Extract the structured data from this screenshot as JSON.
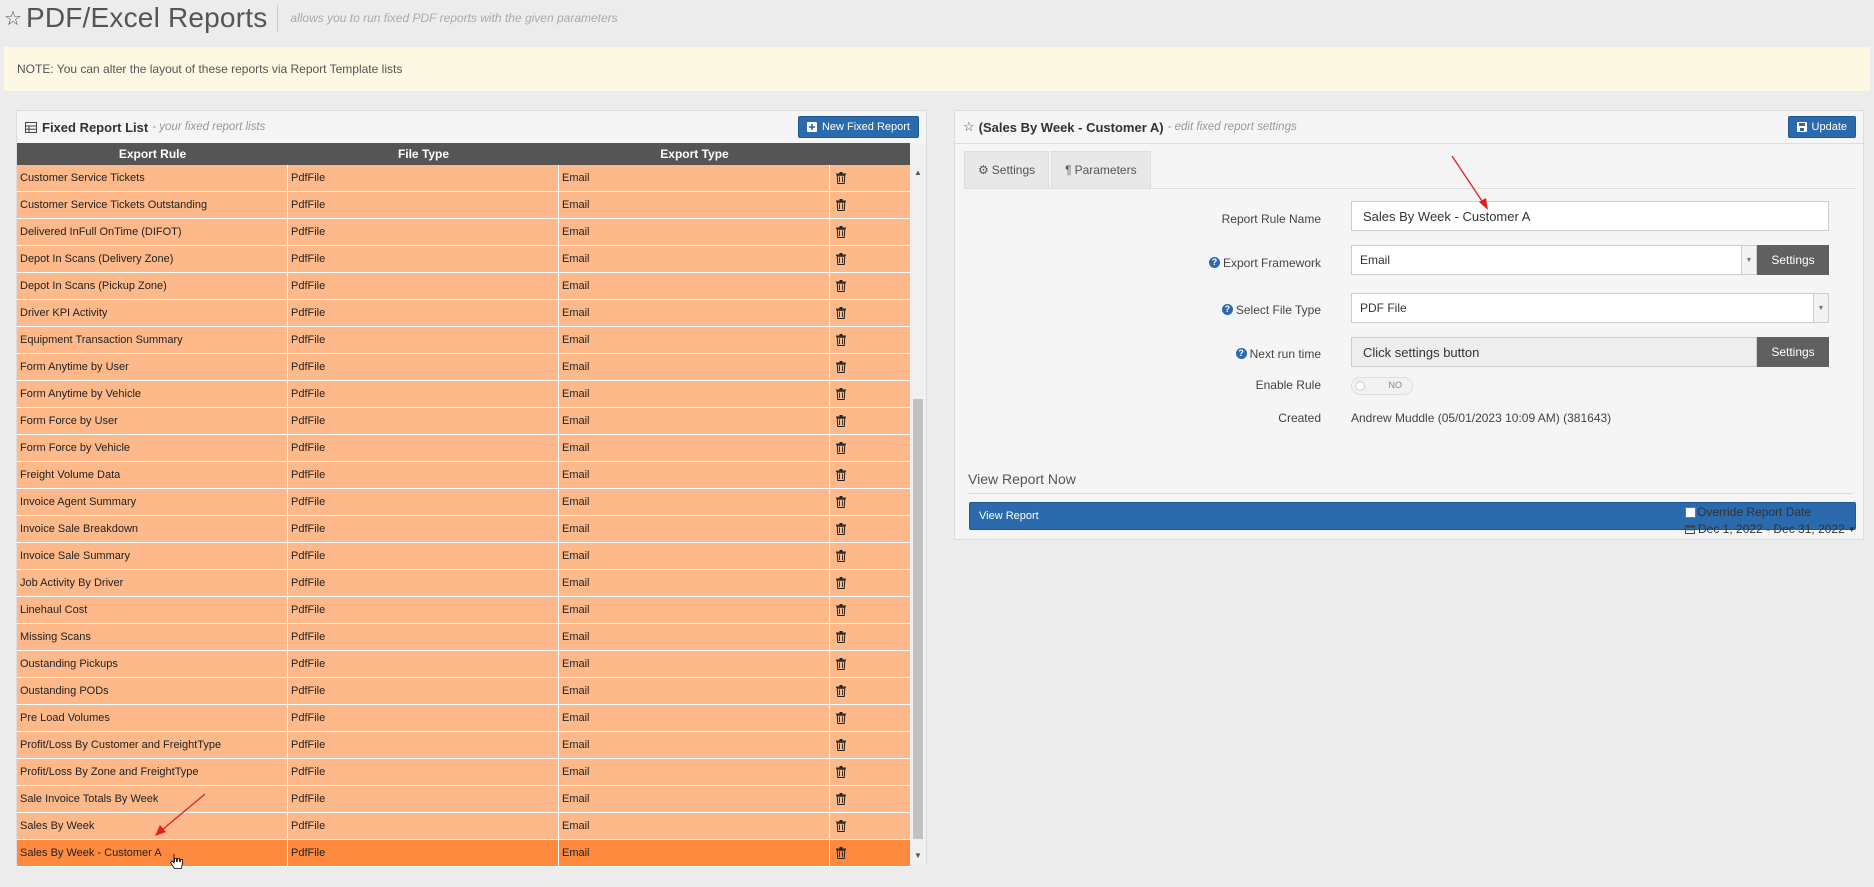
{
  "header": {
    "title": "PDF/Excel Reports",
    "subtitle": "allows you to run fixed PDF reports with the given parameters"
  },
  "note": "NOTE: You can alter the layout of these reports via Report Template lists",
  "left_panel": {
    "title": "Fixed Report List",
    "subtitle": "- your fixed report lists",
    "new_button": "New Fixed Report",
    "columns": [
      "Export Rule",
      "File Type",
      "Export Type",
      ""
    ],
    "rows": [
      {
        "rule": "Customer Service Tickets",
        "file": "PdfFile",
        "export": "Email"
      },
      {
        "rule": "Customer Service Tickets Outstanding",
        "file": "PdfFile",
        "export": "Email"
      },
      {
        "rule": "Delivered InFull OnTime (DIFOT)",
        "file": "PdfFile",
        "export": "Email"
      },
      {
        "rule": "Depot In Scans (Delivery Zone)",
        "file": "PdfFile",
        "export": "Email"
      },
      {
        "rule": "Depot In Scans (Pickup Zone)",
        "file": "PdfFile",
        "export": "Email"
      },
      {
        "rule": "Driver KPI Activity",
        "file": "PdfFile",
        "export": "Email"
      },
      {
        "rule": "Equipment Transaction Summary",
        "file": "PdfFile",
        "export": "Email"
      },
      {
        "rule": "Form Anytime by User",
        "file": "PdfFile",
        "export": "Email"
      },
      {
        "rule": "Form Anytime by Vehicle",
        "file": "PdfFile",
        "export": "Email"
      },
      {
        "rule": "Form Force by User",
        "file": "PdfFile",
        "export": "Email"
      },
      {
        "rule": "Form Force by Vehicle",
        "file": "PdfFile",
        "export": "Email"
      },
      {
        "rule": "Freight Volume Data",
        "file": "PdfFile",
        "export": "Email"
      },
      {
        "rule": "Invoice Agent Summary",
        "file": "PdfFile",
        "export": "Email"
      },
      {
        "rule": "Invoice Sale Breakdown",
        "file": "PdfFile",
        "export": "Email"
      },
      {
        "rule": "Invoice Sale Summary",
        "file": "PdfFile",
        "export": "Email"
      },
      {
        "rule": "Job Activity By Driver",
        "file": "PdfFile",
        "export": "Email"
      },
      {
        "rule": "Linehaul Cost",
        "file": "PdfFile",
        "export": "Email"
      },
      {
        "rule": "Missing Scans",
        "file": "PdfFile",
        "export": "Email"
      },
      {
        "rule": "Oustanding Pickups",
        "file": "PdfFile",
        "export": "Email"
      },
      {
        "rule": "Oustanding PODs",
        "file": "PdfFile",
        "export": "Email"
      },
      {
        "rule": "Pre Load Volumes",
        "file": "PdfFile",
        "export": "Email"
      },
      {
        "rule": "Profit/Loss By Customer and FreightType",
        "file": "PdfFile",
        "export": "Email"
      },
      {
        "rule": "Profit/Loss By Zone and FreightType",
        "file": "PdfFile",
        "export": "Email"
      },
      {
        "rule": "Sale Invoice Totals By Week",
        "file": "PdfFile",
        "export": "Email"
      },
      {
        "rule": "Sales By Week",
        "file": "PdfFile",
        "export": "Email"
      },
      {
        "rule": "Sales By Week - Customer A",
        "file": "PdfFile",
        "export": "Email",
        "selected": true
      }
    ]
  },
  "right_panel": {
    "title": "(Sales By Week - Customer A)",
    "subtitle": "- edit fixed report settings",
    "update_button": "Update",
    "tabs": [
      "Settings",
      "Parameters"
    ],
    "fields": {
      "report_rule_name_label": "Report Rule Name",
      "report_rule_name_value": "Sales By Week - Customer A",
      "export_framework_label": "Export Framework",
      "export_framework_value": "Email",
      "export_framework_button": "Settings",
      "file_type_label": "Select File Type",
      "file_type_value": "PDF File",
      "next_run_label": "Next run time",
      "next_run_value": "Click settings button",
      "next_run_button": "Settings",
      "enable_rule_label": "Enable Rule",
      "enable_rule_value": "NO",
      "created_label": "Created",
      "created_value": "Andrew Muddle (05/01/2023 10:09 AM) (381643)"
    },
    "view_section_title": "View Report Now",
    "view_button": "View Report",
    "override_label": "Override Report Date",
    "date_range": "Dec 1, 2022 - Dec 31, 2022"
  },
  "colors": {
    "row_bg": "#fdb98a",
    "row_selected": "#fd8a3e",
    "accent_blue": "#2a6aad",
    "annotation_arrow": "#e02020"
  }
}
